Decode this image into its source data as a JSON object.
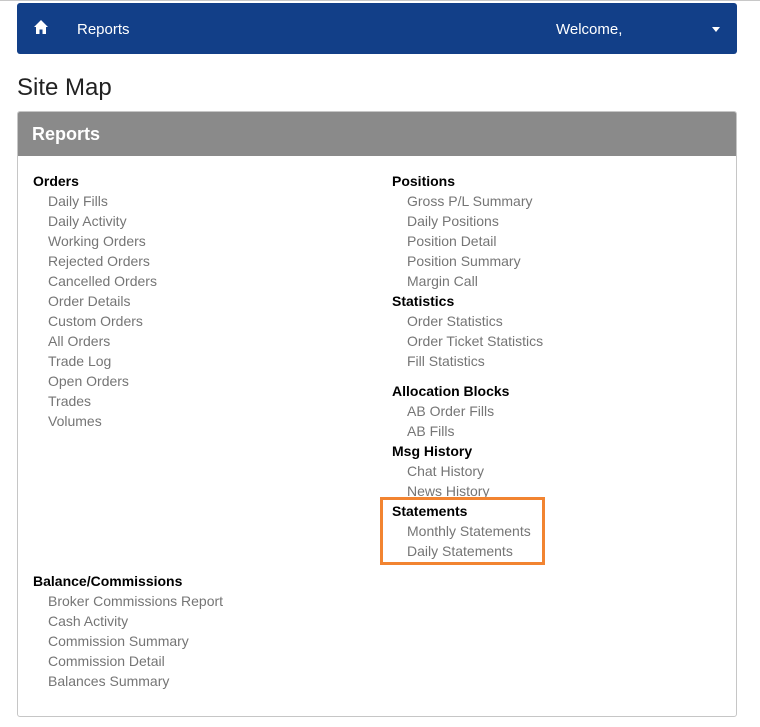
{
  "navbar": {
    "title": "Reports",
    "welcome": "Welcome,"
  },
  "page": {
    "title": "Site Map"
  },
  "panel": {
    "heading": "Reports"
  },
  "sections": {
    "orders": {
      "title": "Orders",
      "items": [
        "Daily Fills",
        "Daily Activity",
        "Working Orders",
        "Rejected Orders",
        "Cancelled Orders",
        "Order Details",
        "Custom Orders",
        "All Orders",
        "Trade Log",
        "Open Orders",
        "Trades",
        "Volumes"
      ]
    },
    "positions": {
      "title": "Positions",
      "items": [
        "Gross P/L Summary",
        "Daily Positions",
        "Position Detail",
        "Position Summary",
        "Margin Call"
      ]
    },
    "statistics": {
      "title": "Statistics",
      "items": [
        "Order Statistics",
        "Order Ticket Statistics",
        "Fill Statistics"
      ]
    },
    "allocation": {
      "title": "Allocation Blocks",
      "items": [
        "AB Order Fills",
        "AB Fills"
      ]
    },
    "msg": {
      "title": "Msg History",
      "items": [
        "Chat History",
        "News History"
      ]
    },
    "statements": {
      "title": "Statements",
      "items": [
        "Monthly Statements",
        "Daily Statements"
      ]
    },
    "balance": {
      "title": "Balance/Commissions",
      "items": [
        "Broker Commissions Report",
        "Cash Activity",
        "Commission Summary",
        "Commission Detail",
        "Balances Summary"
      ]
    }
  },
  "colors": {
    "navbar": "#123f88",
    "panel_header": "#8a8a8a",
    "link": "#757575",
    "highlight": "#f28431"
  }
}
